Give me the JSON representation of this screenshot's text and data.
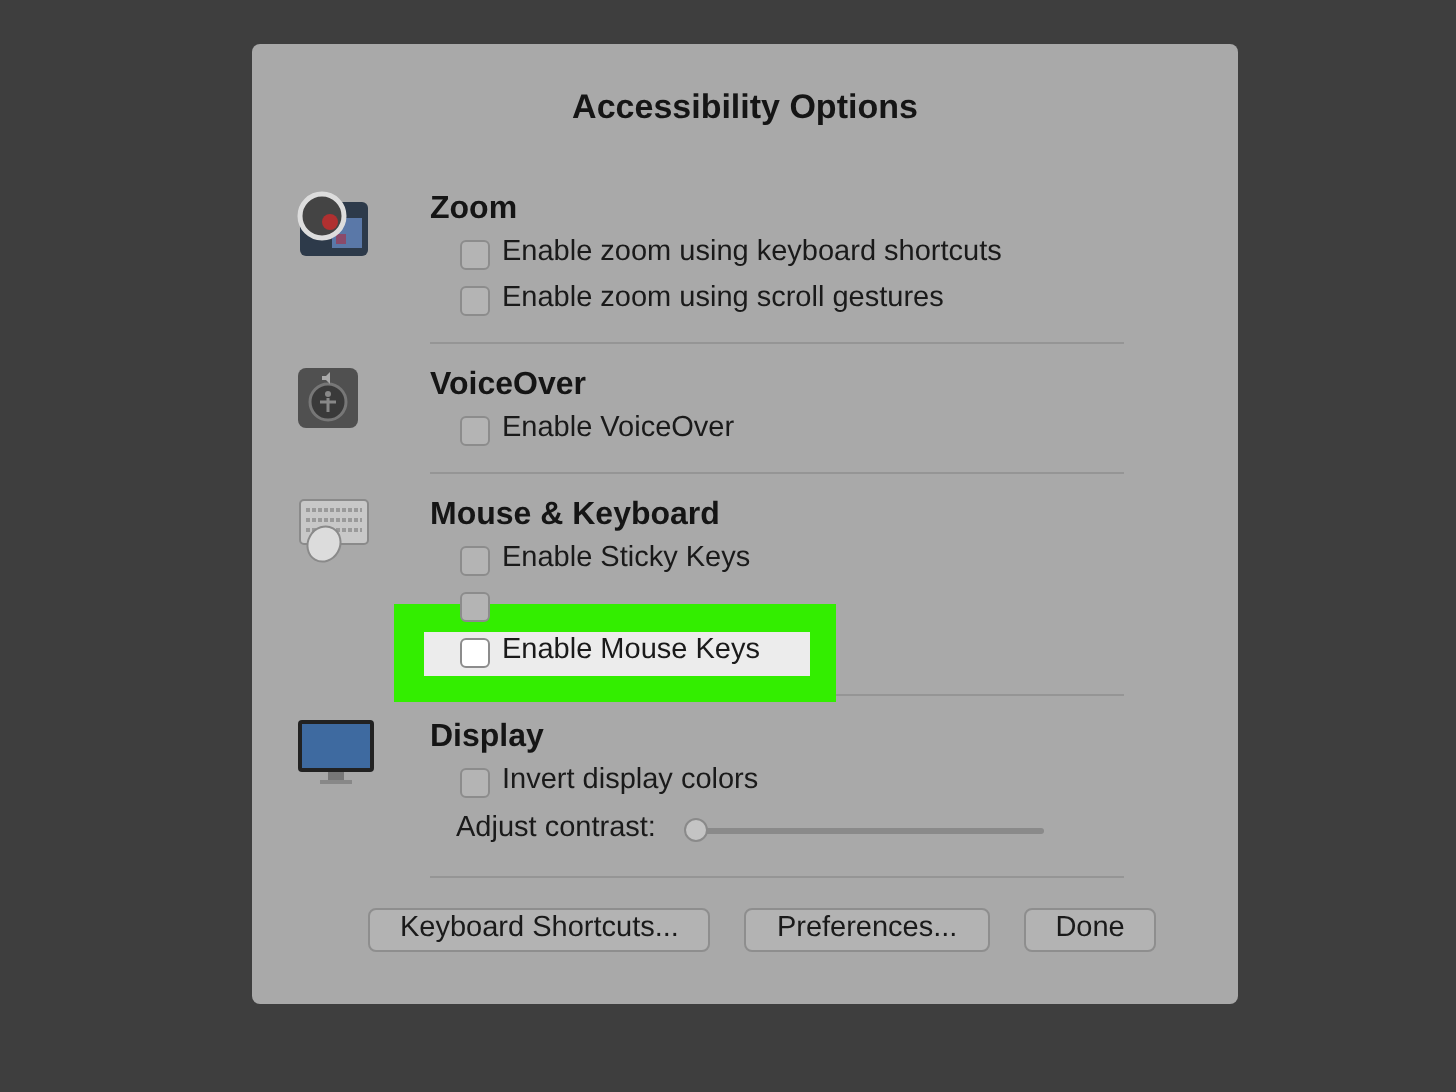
{
  "window": {
    "title": "Accessibility Options"
  },
  "sections": [
    {
      "kind": "zoom",
      "title": "Zoom",
      "items": [
        {
          "kind": "checkbox",
          "label": "Enable zoom using keyboard shortcuts",
          "checked": false,
          "highlighted": false
        },
        {
          "kind": "checkbox",
          "label": "Enable zoom using scroll gestures",
          "checked": false,
          "highlighted": false
        }
      ]
    },
    {
      "kind": "voiceover",
      "title": "VoiceOver",
      "items": [
        {
          "kind": "checkbox",
          "label": "Enable VoiceOver",
          "checked": false,
          "highlighted": false
        }
      ]
    },
    {
      "kind": "keyboard",
      "title": "Mouse & Keyboard",
      "items": [
        {
          "kind": "checkbox",
          "label": "Enable Sticky Keys",
          "checked": false,
          "highlighted": false
        },
        {
          "kind": "checkbox",
          "checked": false,
          "highlighted": false
        },
        {
          "kind": "checkbox",
          "label": "Enable Mouse Keys",
          "checked": false,
          "highlighted": true
        }
      ]
    },
    {
      "kind": "display",
      "title": "Display",
      "items": [
        {
          "kind": "checkbox",
          "label": "Invert display colors",
          "checked": false,
          "highlighted": false
        },
        {
          "kind": "slider",
          "label": "Adjust contrast:",
          "level": 0
        }
      ]
    }
  ],
  "buttons": [
    "Keyboard Shortcuts...",
    "Preferences...",
    "Done"
  ]
}
